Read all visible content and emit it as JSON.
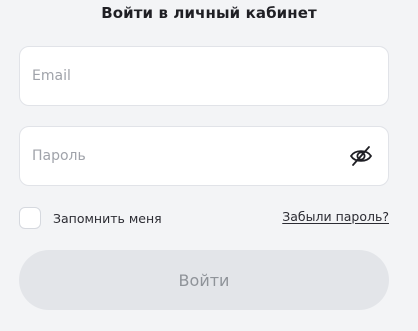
{
  "form": {
    "title": "Войти в личный кабинет",
    "email": {
      "placeholder": "Email",
      "value": ""
    },
    "password": {
      "placeholder": "Пароль",
      "value": "",
      "toggle_icon": "eye-slash-icon"
    },
    "remember_label": "Запомнить меня",
    "remember_checked": false,
    "forgot_link": "Забыли пароль?",
    "submit_label": "Войти"
  },
  "colors": {
    "background": "#f3f4f6",
    "field_bg": "#ffffff",
    "field_border": "#e1e3e8",
    "button_bg": "#e3e5e9",
    "button_text": "#8f9399",
    "placeholder": "#a0a3aa"
  }
}
